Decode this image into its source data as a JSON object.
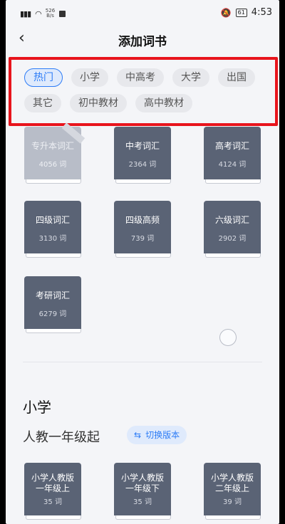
{
  "status_bar": {
    "speed": "526\nB/s",
    "battery": "61",
    "time": "4:53"
  },
  "header": {
    "back_icon": "chevron-left-icon",
    "title": "添加词书"
  },
  "categories": {
    "row1": [
      "热门",
      "小学",
      "中高考",
      "大学",
      "出国"
    ],
    "row2": [
      "其它",
      "初中教材",
      "高中教材"
    ],
    "active": "热门",
    "highlight_color": "#e8141c",
    "active_color": "#2d7cf6"
  },
  "books_top": [
    {
      "name": "专升本词汇",
      "count": "4056 词",
      "faded": true
    },
    {
      "name": "中考词汇",
      "count": "2364 词"
    },
    {
      "name": "高考词汇",
      "count": "4124 词"
    },
    {
      "name": "四级词汇",
      "count": "3130 词"
    },
    {
      "name": "四级高频",
      "count": "739 词"
    },
    {
      "name": "六级词汇",
      "count": "2902 词"
    },
    {
      "name": "考研词汇",
      "count": "6279 词"
    }
  ],
  "section": {
    "title": "小学",
    "edition": "人教一年级起",
    "switch_label": "切换版本",
    "switch_icon": "swap-icon"
  },
  "books_primary": [
    {
      "name": "小学人教版\n一年级上",
      "count": "35 词"
    },
    {
      "name": "小学人教版\n一年级下",
      "count": "35 词"
    },
    {
      "name": "小学人教版\n二年级上",
      "count": "39 词"
    }
  ]
}
